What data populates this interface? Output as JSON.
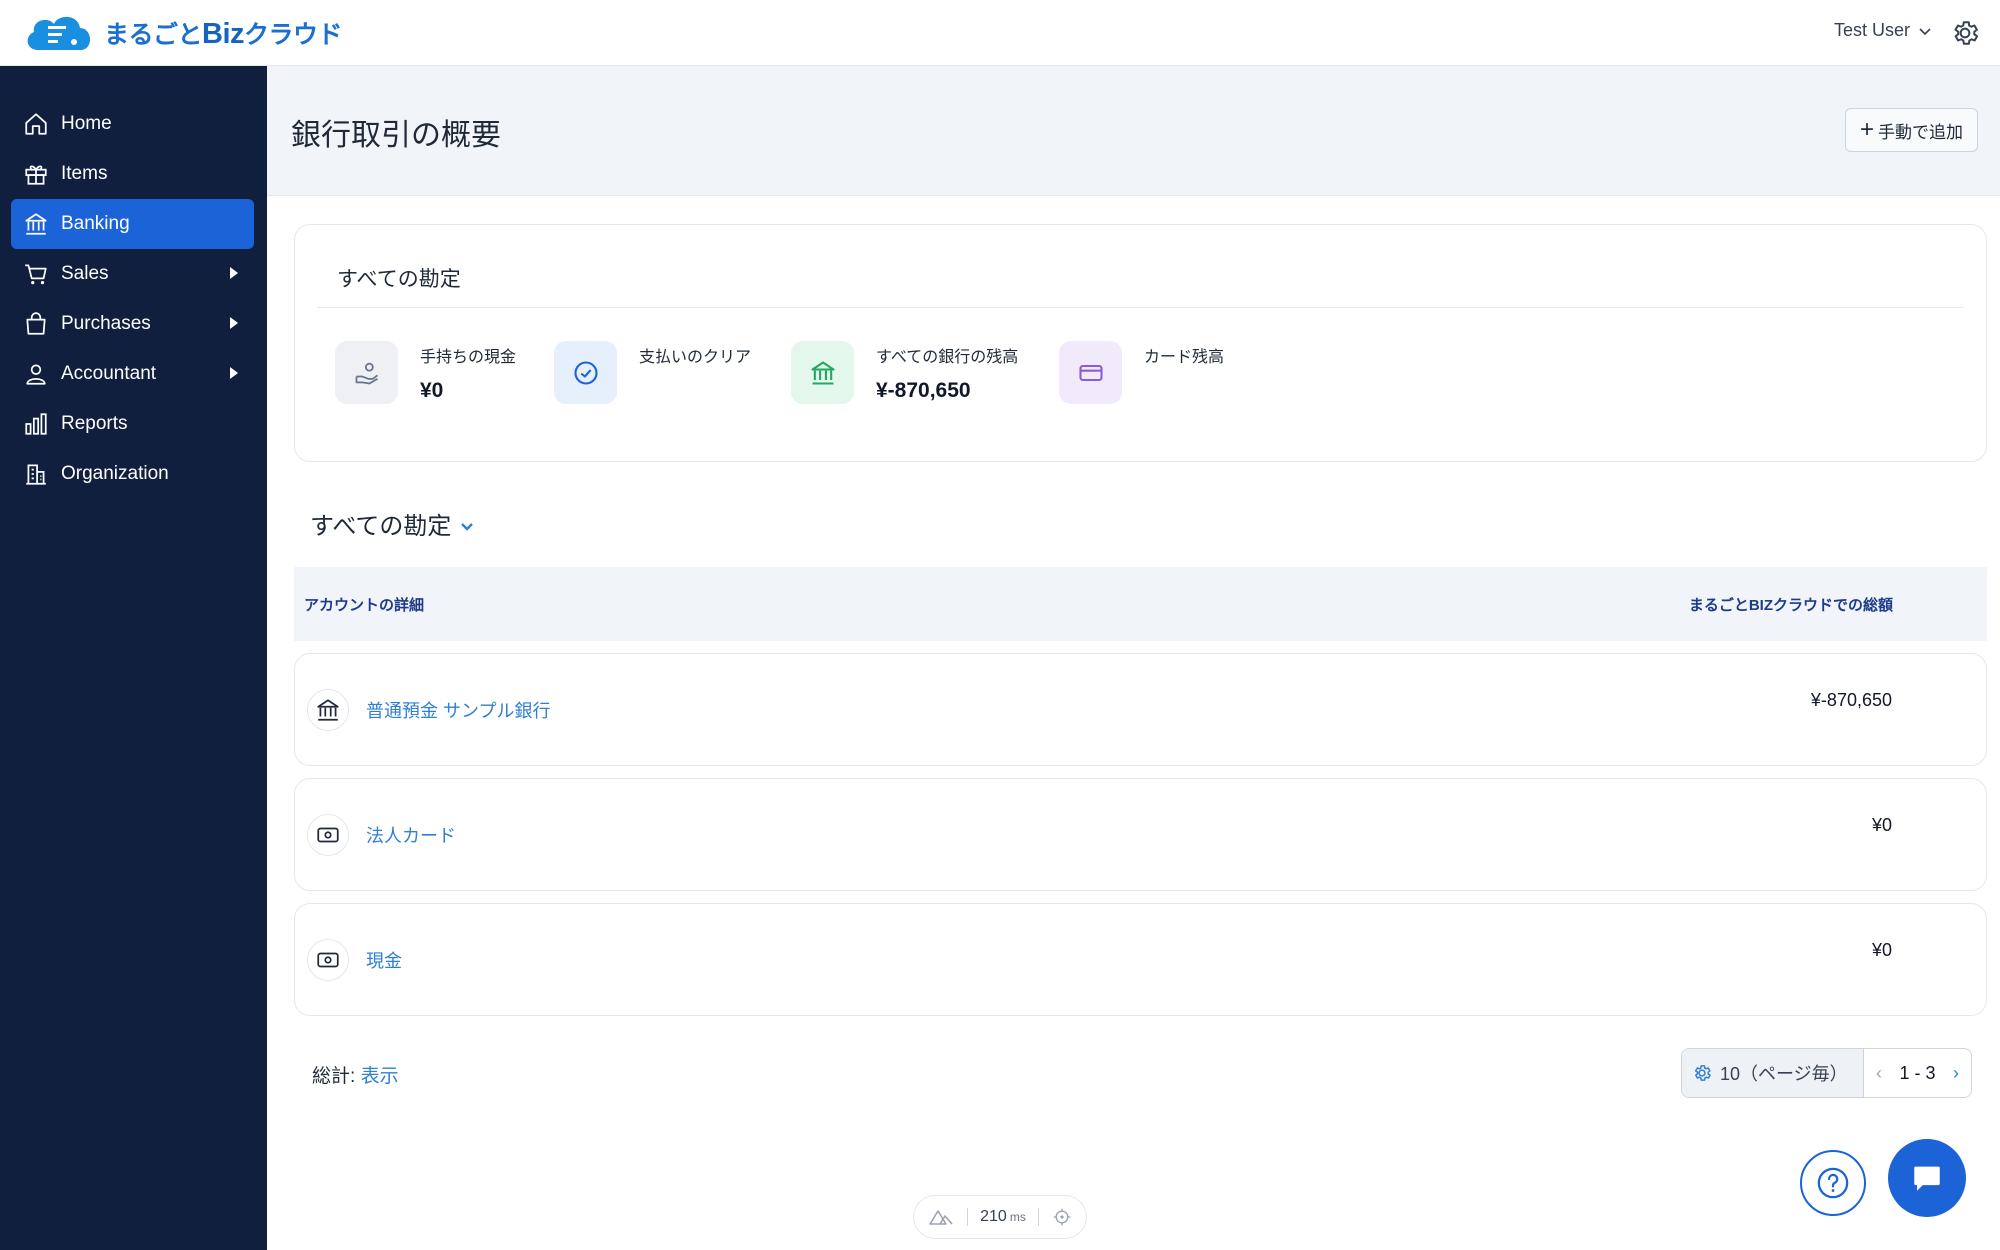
{
  "brand": {
    "name": "まるごと",
    "name_biz": "Biz",
    "name_suffix": "クラウド"
  },
  "header": {
    "user_name": "Test User"
  },
  "sidebar": {
    "items": [
      {
        "label": "Home",
        "icon": "home-icon"
      },
      {
        "label": "Items",
        "icon": "gift-icon"
      },
      {
        "label": "Banking",
        "icon": "bank-icon",
        "active": true
      },
      {
        "label": "Sales",
        "icon": "cart-icon",
        "has_submenu": true
      },
      {
        "label": "Purchases",
        "icon": "bag-icon",
        "has_submenu": true
      },
      {
        "label": "Accountant",
        "icon": "person-icon",
        "has_submenu": true
      },
      {
        "label": "Reports",
        "icon": "bar-chart-icon"
      },
      {
        "label": "Organization",
        "icon": "building-icon"
      }
    ]
  },
  "page": {
    "title": "銀行取引の概要",
    "add_button": "手動で追加"
  },
  "summary": {
    "title": "すべての勘定",
    "stats": [
      {
        "label": "手持ちの現金",
        "value": "¥0",
        "icon": "hand-coin-icon"
      },
      {
        "label": "支払いのクリア",
        "value": "",
        "icon": "check-circle-icon"
      },
      {
        "label": "すべての銀行の残高",
        "value": "¥-870,650",
        "icon": "bank-icon"
      },
      {
        "label": "カード残高",
        "value": "",
        "icon": "credit-card-icon"
      }
    ]
  },
  "accounts": {
    "section_title": "すべての勘定",
    "columns": {
      "detail": "アカウントの詳細",
      "total": "まるごとBIZクラウドでの総額"
    },
    "rows": [
      {
        "name": "普通預金 サンプル銀行",
        "amount": "¥-870,650",
        "icon": "bank-icon"
      },
      {
        "name": "法人カード",
        "amount": "¥0",
        "icon": "cash-icon"
      },
      {
        "name": "現金",
        "amount": "¥0",
        "icon": "cash-icon"
      }
    ]
  },
  "footer": {
    "total_label": "総計:",
    "total_link": "表示",
    "per_page": "10（ページ毎）",
    "range": "1 - 3"
  },
  "perf": {
    "value": "210",
    "unit": "ms"
  },
  "colors": {
    "sidebar": "#0f1f3d",
    "accent": "#1b63d6",
    "link": "#2f7fd6"
  }
}
